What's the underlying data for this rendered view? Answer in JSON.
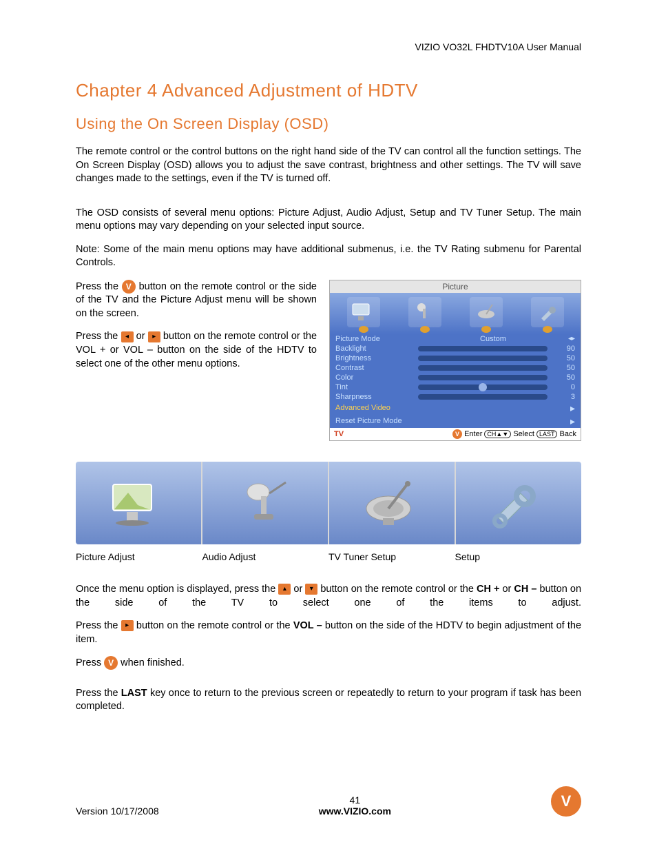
{
  "header": {
    "manual_title": "VIZIO VO32L FHDTV10A User Manual"
  },
  "chapter": {
    "title": "Chapter 4 Advanced Adjustment of HDTV"
  },
  "section": {
    "title": "Using the On Screen Display (OSD)"
  },
  "para": {
    "p1": "The remote control or the control buttons on the right hand side of the TV can control all the function settings.  The On Screen Display (OSD) allows you to adjust the save contrast, brightness and other settings.  The TV will save changes made to the settings, even if the TV is turned off.",
    "p2": "The OSD consists of several menu options: Picture Adjust, Audio Adjust, Setup and TV Tuner Setup. The main menu options may vary depending on your selected input source.",
    "p3": "Note:  Some of the main menu options may have additional submenus, i.e. the TV Rating submenu for Parental Controls.",
    "p4a": "Press the ",
    "p4b": " button on the remote control or the side of the TV and the Picture Adjust menu will be shown on the screen.",
    "p5a": "Press the  ",
    "p5b": "  or  ",
    "p5c": "   button on the remote control or the VOL + or VOL – button on the side of the HDTV to select one of the other menu options.",
    "p6a": "Once the menu option is displayed, press the ",
    "p6b": " or ",
    "p6c": "    button on the remote control or the ",
    "p6d": " or ",
    "p6e": " button on the side of the TV to select one of the items to adjust.",
    "ch_plus": "CH +",
    "ch_minus": "CH –",
    "p7a": "Press the   ",
    "p7b": "   button on the remote control or the ",
    "vol_minus": "VOL –",
    "p7c": " button on the side of the HDTV to begin adjustment of the item.",
    "p8a": "Press ",
    "p8b": " when finished.",
    "p9a": "Press the ",
    "last_key": "LAST",
    "p9b": " key once to return to the previous screen or repeatedly to return to your program if task has been completed."
  },
  "osd": {
    "title": "Picture",
    "rows": [
      {
        "label": "Picture Mode",
        "type": "text",
        "value": "Custom"
      },
      {
        "label": "Backlight",
        "type": "bar",
        "value": 90
      },
      {
        "label": "Brightness",
        "type": "bar",
        "value": 50
      },
      {
        "label": "Contrast",
        "type": "bar",
        "value": 50
      },
      {
        "label": "Color",
        "type": "bar",
        "value": 50
      },
      {
        "label": "Tint",
        "type": "center",
        "value": 0
      },
      {
        "label": "Sharpness",
        "type": "bar",
        "value": 3
      },
      {
        "label": "Advanced Video",
        "type": "arrow",
        "highlight": true
      },
      {
        "label": "Reset Picture Mode",
        "type": "arrow"
      }
    ],
    "footer": {
      "src": "TV",
      "enter": "Enter",
      "select": "Select",
      "back": "Back",
      "ch_pill": "CH▲▼",
      "last_pill": "LAST"
    }
  },
  "strip": {
    "labels": [
      "Picture Adjust",
      "Audio Adjust",
      "TV Tuner Setup",
      "Setup"
    ]
  },
  "footer": {
    "version": "Version 10/17/2008",
    "page": "41",
    "url": "www.VIZIO.com"
  }
}
